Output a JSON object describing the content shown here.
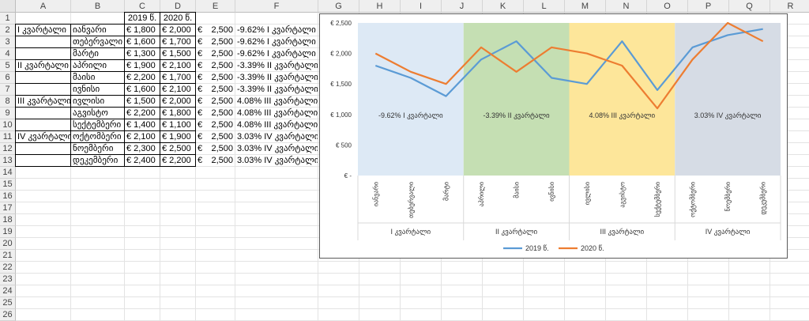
{
  "columns": [
    "A",
    "B",
    "C",
    "D",
    "E",
    "F",
    "G",
    "H",
    "I",
    "J",
    "K",
    "L",
    "M",
    "N",
    "O",
    "P",
    "Q",
    "R"
  ],
  "rows": [
    "1",
    "2",
    "3",
    "4",
    "5",
    "6",
    "7",
    "8",
    "9",
    "10",
    "11",
    "12",
    "13",
    "14",
    "15",
    "16",
    "17",
    "18",
    "19",
    "20",
    "21",
    "22",
    "23",
    "24",
    "25",
    "26"
  ],
  "table": {
    "headers": {
      "c": "2019 წ.",
      "d": "2020 წ."
    },
    "rows": [
      {
        "a": "I კვარტალი",
        "b": "იანვარი",
        "c": "€ 1,800",
        "d": "€ 2,000",
        "e1": "€",
        "e2": "2,500",
        "f": "-9.62% I კვარტალი"
      },
      {
        "a": "",
        "b": "თებერვალი",
        "c": "€ 1,600",
        "d": "€ 1,700",
        "e1": "€",
        "e2": "2,500",
        "f": "-9.62% I კვარტალი"
      },
      {
        "a": "",
        "b": "მარტი",
        "c": "€ 1,300",
        "d": "€ 1,500",
        "e1": "€",
        "e2": "2,500",
        "f": "-9.62% I კვარტალი"
      },
      {
        "a": "II კვარტალი",
        "b": "აპრილი",
        "c": "€ 1,900",
        "d": "€ 2,100",
        "e1": "€",
        "e2": "2,500",
        "f": "-3.39% II კვარტალი"
      },
      {
        "a": "",
        "b": "მაისი",
        "c": "€ 2,200",
        "d": "€ 1,700",
        "e1": "€",
        "e2": "2,500",
        "f": "-3.39% II კვარტალი"
      },
      {
        "a": "",
        "b": "ივნისი",
        "c": "€ 1,600",
        "d": "€ 2,100",
        "e1": "€",
        "e2": "2,500",
        "f": "-3.39% II კვარტალი"
      },
      {
        "a": "III კვარტალი",
        "b": "ივლისი",
        "c": "€ 1,500",
        "d": "€ 2,000",
        "e1": "€",
        "e2": "2,500",
        "f": "4.08% III კვარტალი"
      },
      {
        "a": "",
        "b": "აგვისტო",
        "c": "€ 2,200",
        "d": "€ 1,800",
        "e1": "€",
        "e2": "2,500",
        "f": "4.08% III კვარტალი"
      },
      {
        "a": "",
        "b": "სექტემბერი",
        "c": "€ 1,400",
        "d": "€ 1,100",
        "e1": "€",
        "e2": "2,500",
        "f": "4.08% III კვარტალი"
      },
      {
        "a": "IV კვარტალი",
        "b": "ოქტომბერი",
        "c": "€ 2,100",
        "d": "€ 1,900",
        "e1": "€",
        "e2": "2,500",
        "f": "3.03% IV კვარტალი"
      },
      {
        "a": "",
        "b": "ნოემბერი",
        "c": "€ 2,300",
        "d": "€ 2,500",
        "e1": "€",
        "e2": "2,500",
        "f": "3.03% IV კვარტალი"
      },
      {
        "a": "",
        "b": "დეკემბერი",
        "c": "€ 2,400",
        "d": "€ 2,200",
        "e1": "€",
        "e2": "2,500",
        "f": "3.03% IV კვარტალი"
      }
    ]
  },
  "colors": {
    "series1": "#5b9bd5",
    "series2": "#ed7d31",
    "q1": "#dde9f5",
    "q2": "#c5dfb3",
    "q3": "#fde69a",
    "q4": "#d6dce5"
  },
  "chart_data": {
    "type": "line",
    "categories": [
      "იანვარი",
      "თებერვალი",
      "მარტი",
      "აპრილი",
      "მაისი",
      "ივნისი",
      "ივლისი",
      "აგვისტო",
      "სექტემბერი",
      "ოქტომბერი",
      "ნოემბერი",
      "დეკემბერი"
    ],
    "groups": [
      "I კვარტალი",
      "II კვარტალი",
      "III კვარტალი",
      "IV კვარტალი"
    ],
    "group_labels": [
      "-9.62% I კვარტალი",
      "-3.39% II კვარტალი",
      "4.08% III კვარტალი",
      "3.03% IV კვარტალი"
    ],
    "series": [
      {
        "name": "2019 წ.",
        "values": [
          1800,
          1600,
          1300,
          1900,
          2200,
          1600,
          1500,
          2200,
          1400,
          2100,
          2300,
          2400
        ]
      },
      {
        "name": "2020 წ.",
        "values": [
          2000,
          1700,
          1500,
          2100,
          1700,
          2100,
          2000,
          1800,
          1100,
          1900,
          2500,
          2200
        ]
      }
    ],
    "background_band_value": 2500,
    "y_ticks": [
      "€ -",
      "€ 500",
      "€ 1,000",
      "€ 1,500",
      "€ 2,000",
      "€ 2,500"
    ],
    "ylim": [
      0,
      2500
    ],
    "legend": "bottom"
  }
}
